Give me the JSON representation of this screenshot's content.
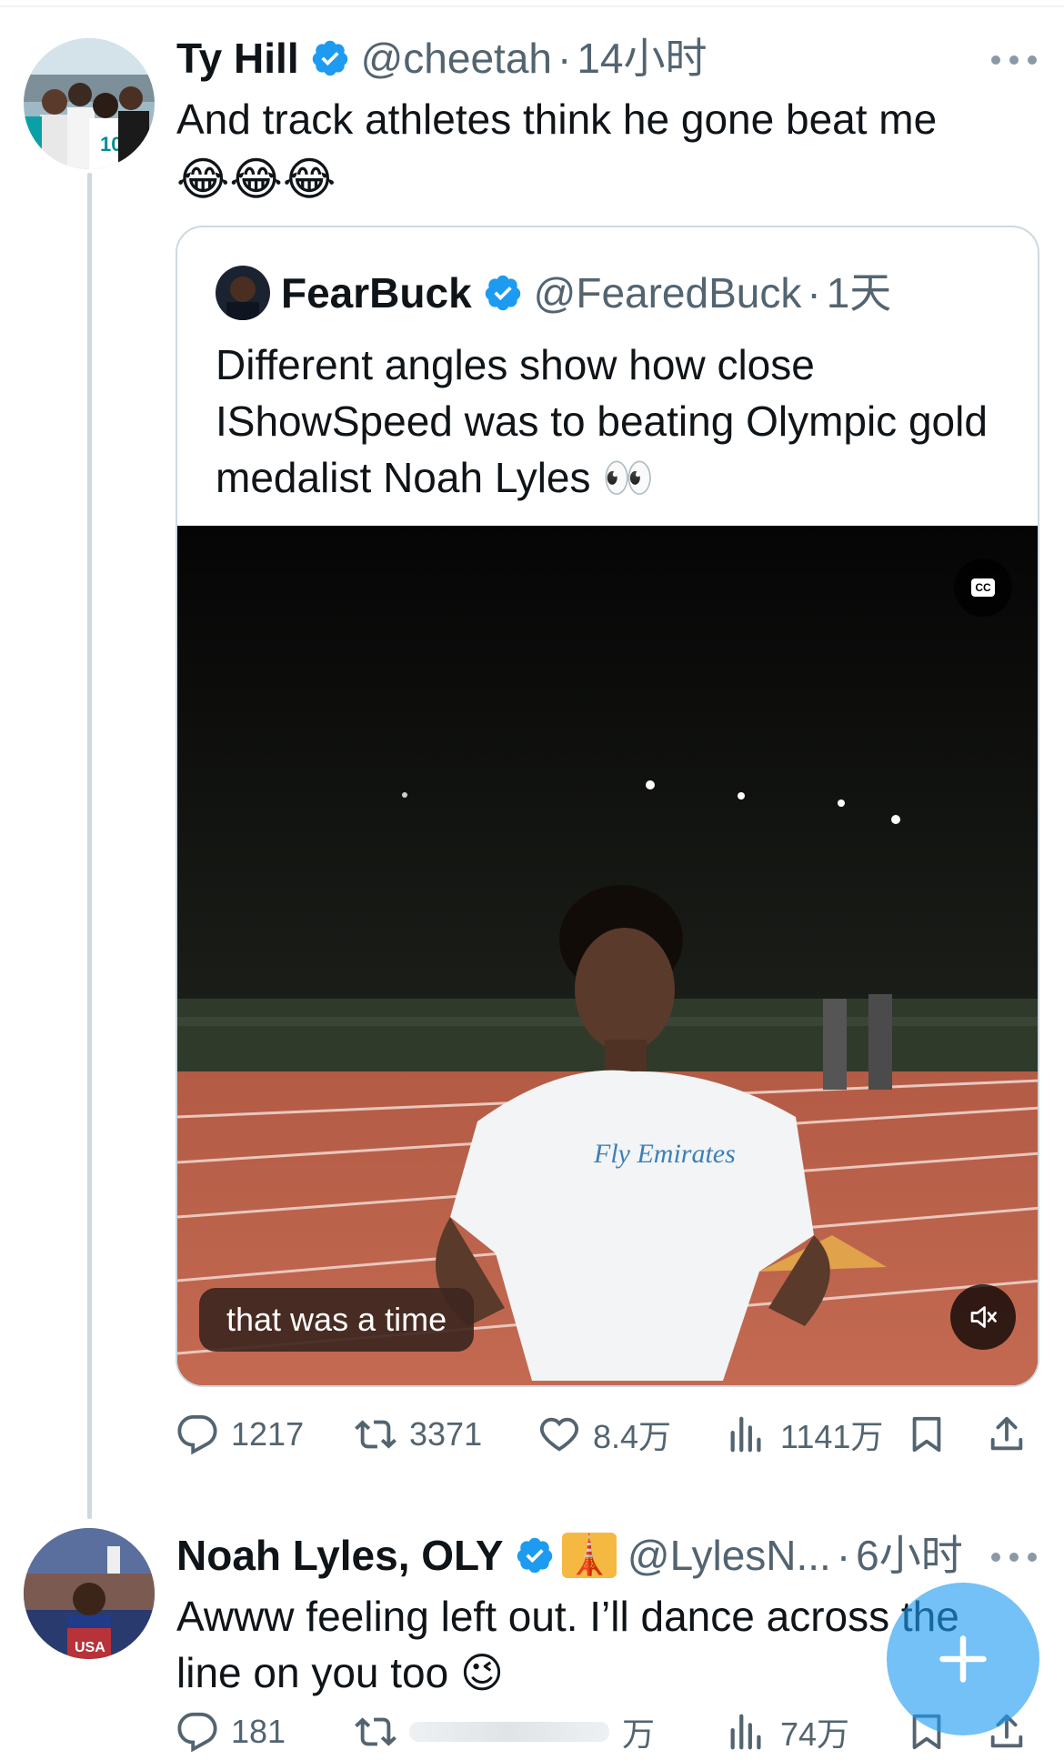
{
  "tweets": [
    {
      "name": "Ty Hill",
      "handle": "@cheetah",
      "time": "14小时",
      "text": "And track athletes think he gone beat me",
      "emoji": "😂😂😂",
      "actions": {
        "reply": "1217",
        "retweet": "3371",
        "like": "8.4万",
        "views": "1141万"
      },
      "quote": {
        "name": "FearBuck",
        "handle": "@FearedBuck",
        "time": "1天",
        "text": "Different angles show how close IShowSpeed was to beating Olympic gold medalist Noah Lyles 👀",
        "video": {
          "caption": "that was a time",
          "cc_label": "CC",
          "jersey_text": "Fly Emirates"
        }
      }
    },
    {
      "name": "Noah Lyles, OLY",
      "handle": "@LylesN...",
      "time": "6小时",
      "text": "Awww feeling left out. I’ll dance across the line on you too",
      "emoji": "😉",
      "badge_emoji": "🗼",
      "actions": {
        "reply": "181",
        "views": "74万",
        "partial": "万"
      }
    }
  ],
  "separator": "·",
  "colors": {
    "verified": "#1d9bf0",
    "text": "#0f1419",
    "muted": "#536471",
    "fab": "#1d9bf0"
  },
  "icons": [
    "verified-badge-icon",
    "more-icon",
    "reply-icon",
    "retweet-icon",
    "like-icon",
    "views-icon",
    "bookmark-icon",
    "share-icon",
    "cc-icon",
    "mute-icon",
    "compose-plus-icon"
  ]
}
